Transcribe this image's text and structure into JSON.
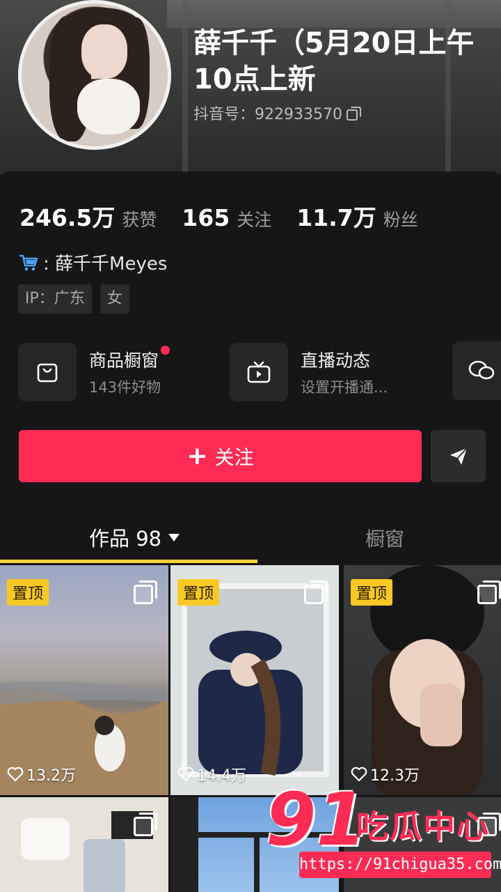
{
  "profile": {
    "name": "薛千千（5月20日上午10点上新",
    "douyin_id_label": "抖音号：922933570"
  },
  "stats": [
    {
      "value": "246.5万",
      "label": "获赞"
    },
    {
      "value": "165",
      "label": "关注"
    },
    {
      "value": "11.7万",
      "label": "粉丝"
    }
  ],
  "shop_line": ": 薛千千Meyes",
  "tags": [
    "IP：广东",
    "女"
  ],
  "features": [
    {
      "title": "商品橱窗",
      "subtitle": "143件好物"
    },
    {
      "title": "直播动态",
      "subtitle": "设置开播通..."
    }
  ],
  "actions": {
    "follow_plus": "+",
    "follow_label": "关注"
  },
  "tabs": {
    "works": "作品 98",
    "shop": "橱窗"
  },
  "videos": [
    {
      "pinned": "置顶",
      "likes": "13.2万"
    },
    {
      "pinned": "置顶",
      "likes": "14.4万"
    },
    {
      "pinned": "置顶",
      "likes": "12.3万"
    }
  ],
  "watermark": {
    "number": "91",
    "text": "吃瓜中心",
    "url": "https://91chigua35.com"
  },
  "colors": {
    "accent": "#fe2c55",
    "pin": "#f8c924",
    "tab_underline": "#fbd23c",
    "background": "#161616"
  }
}
